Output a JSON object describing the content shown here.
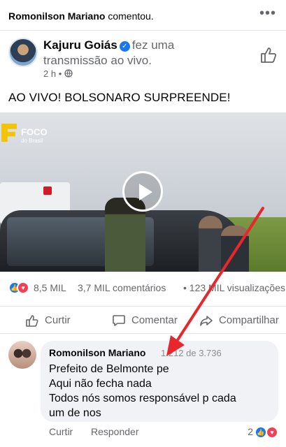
{
  "notification": {
    "actor": "Romonilson Mariano",
    "action": "comentou.",
    "more_icon": "more-horizontal-icon"
  },
  "post": {
    "author": "Kajuru Goiás",
    "author_action_line1": "fez uma",
    "author_action_line2": "transmissão ao vivo.",
    "time": "2 h",
    "privacy_icon": "globe-icon",
    "text": "AO VIVO! BOLSONARO SURPREENDE!",
    "video": {
      "logo_text": "FOCO",
      "logo_sub": "do Brasil",
      "play_icon": "play-icon"
    }
  },
  "stats": {
    "reactions_count": "8,5 MIL",
    "comments": "3,7 MIL comentários",
    "views": "• 123 MIL visualizações"
  },
  "actions": {
    "like": "Curtir",
    "comment": "Comentar",
    "share": "Compartilhar"
  },
  "comment": {
    "author": "Romonilson Mariano",
    "count": "1.212 de 3.736",
    "lines": [
      "Prefeito de Belmonte pe",
      "Aqui não fecha nada",
      "Todos nós somos responsável p cada",
      "um de nos"
    ],
    "like": "Curtir",
    "reply": "Responder",
    "reactions_count": "2"
  },
  "colors": {
    "facebook_blue": "#1877f2",
    "love_red": "#f33e58",
    "annotation_arrow": "#e8262b"
  }
}
